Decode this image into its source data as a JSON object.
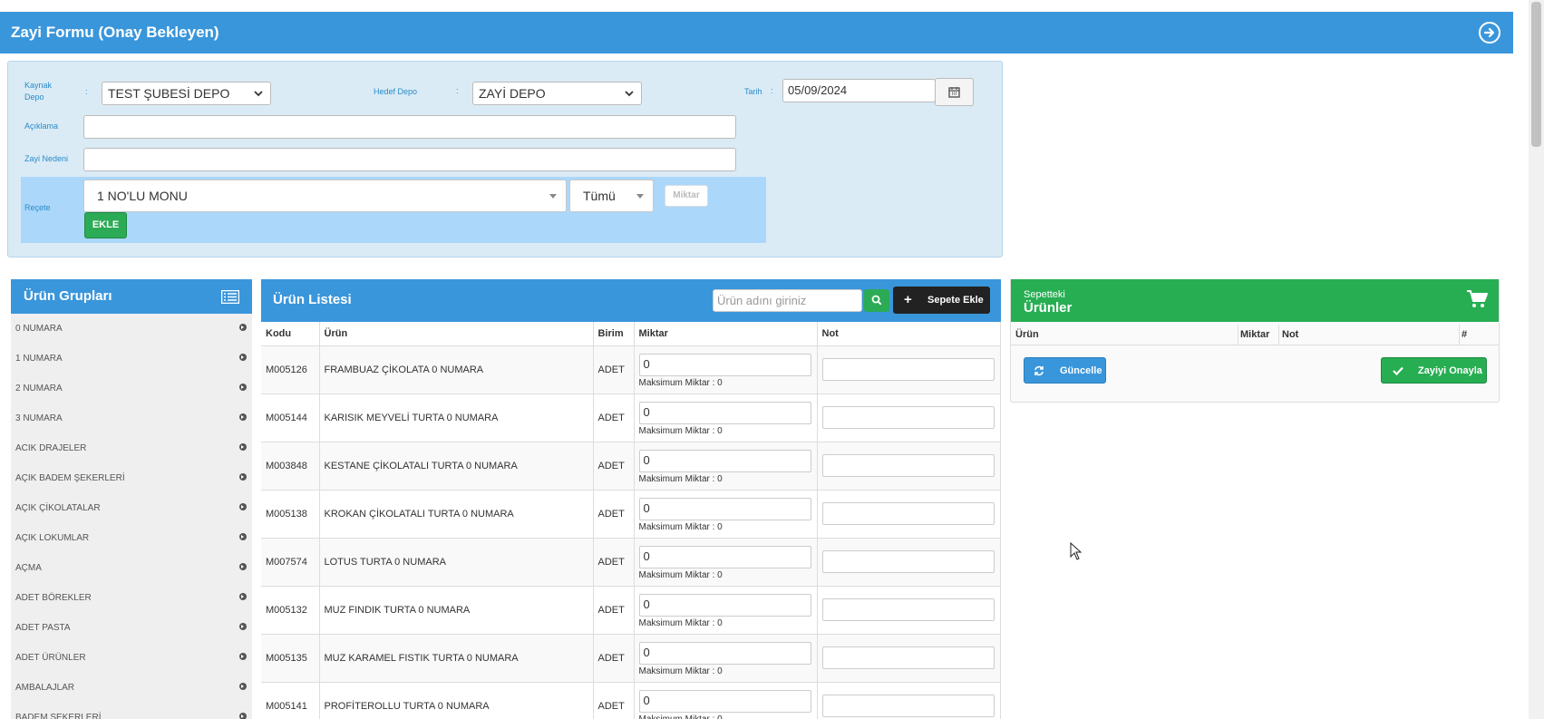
{
  "header": {
    "title": "Zayi Formu (Onay Bekleyen)",
    "nav_icon": "arrow-circle-right-icon"
  },
  "form": {
    "kaynak_label": "Kaynak\nDepo",
    "kaynak_value": "TEST ŞUBESİ DEPO",
    "hedef_label": "Hedef Depo",
    "hedef_value": "ZAYİ DEPO",
    "tarih_label": "Tarih",
    "tarih_value": "05/09/2024",
    "aciklama_label": "Açıklama",
    "aciklama_value": "",
    "zayi_nedeni_label": "Zayi Nedeni",
    "zayi_nedeni_value": "",
    "recete_label": "Reçete",
    "recete_value": "1 NO'LU MONU",
    "filter_value": "Tümü",
    "miktar_placeholder": "Miktar",
    "ekle_label": "EKLE",
    "colon": ":"
  },
  "groups": {
    "title": "Ürün Grupları",
    "items": [
      "0 NUMARA",
      "1 NUMARA",
      "2 NUMARA",
      "3 NUMARA",
      "ACIK DRAJELER",
      "AÇIK BADEM ŞEKERLERİ",
      "AÇIK ÇİKOLATALAR",
      "AÇIK LOKUMLAR",
      "AÇMA",
      "ADET BÖREKLER",
      "ADET PASTA",
      "ADET ÜRÜNLER",
      "AMBALAJLAR",
      "BADEM ŞEKERLERİ"
    ]
  },
  "products": {
    "title": "Ürün Listesi",
    "search_placeholder": "Ürün adını giriniz",
    "add_button": "Sepete Ekle",
    "columns": [
      "Kodu",
      "Ürün",
      "Birim",
      "Miktar",
      "Not"
    ],
    "max_label": "Maksimum Miktar : 0",
    "rows": [
      {
        "kodu": "M005126",
        "urun": "FRAMBUAZ ÇİKOLATA 0 NUMARA",
        "birim": "ADET",
        "miktar": "0"
      },
      {
        "kodu": "M005144",
        "urun": "KARISIK MEYVELİ TURTA 0 NUMARA",
        "birim": "ADET",
        "miktar": "0"
      },
      {
        "kodu": "M003848",
        "urun": "KESTANE ÇİKOLATALI TURTA 0 NUMARA",
        "birim": "ADET",
        "miktar": "0"
      },
      {
        "kodu": "M005138",
        "urun": "KROKAN ÇİKOLATALI TURTA 0 NUMARA",
        "birim": "ADET",
        "miktar": "0"
      },
      {
        "kodu": "M007574",
        "urun": "LOTUS TURTA 0 NUMARA",
        "birim": "ADET",
        "miktar": "0"
      },
      {
        "kodu": "M005132",
        "urun": "MUZ FINDIK TURTA 0 NUMARA",
        "birim": "ADET",
        "miktar": "0"
      },
      {
        "kodu": "M005135",
        "urun": "MUZ KARAMEL FISTIK TURTA 0 NUMARA",
        "birim": "ADET",
        "miktar": "0"
      },
      {
        "kodu": "M005141",
        "urun": "PROFİTEROLLU TURTA 0 NUMARA",
        "birim": "ADET",
        "miktar": "0"
      }
    ]
  },
  "basket": {
    "subtitle": "Sepetteki",
    "title": "Ürünler",
    "columns": [
      "Ürün",
      "Miktar",
      "Not",
      "#"
    ],
    "update_button": "Güncelle",
    "approve_button": "Zayiyi Onayla"
  },
  "colors": {
    "primary": "#3a96db",
    "success": "#27ae53",
    "form_bg": "#daebf5",
    "recete_bg": "#abd7fa"
  }
}
